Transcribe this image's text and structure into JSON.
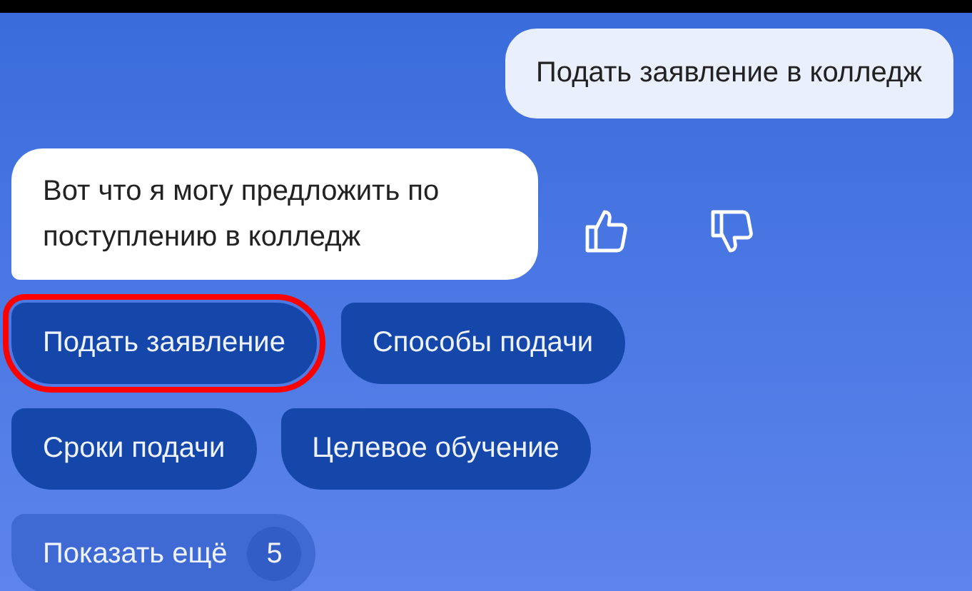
{
  "messages": [
    {
      "kind": "user",
      "text": "Подать заявление в колледж"
    },
    {
      "kind": "bot",
      "text": "Вот что я могу предложить по поступлению в колледж"
    }
  ],
  "feedback": {
    "liked": false,
    "disliked": false
  },
  "suggestions": [
    {
      "label": "Подать заявление",
      "highlighted": true
    },
    {
      "label": "Способы подачи",
      "highlighted": false
    },
    {
      "label": "Сроки подачи",
      "highlighted": false
    },
    {
      "label": "Целевое обучение",
      "highlighted": false
    }
  ],
  "show_more": {
    "label": "Показать ещё",
    "count": "5"
  }
}
